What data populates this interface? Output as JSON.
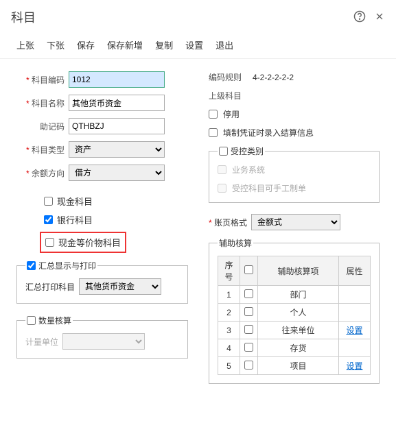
{
  "header": {
    "title": "科目"
  },
  "toolbar": {
    "prev": "上张",
    "next": "下张",
    "save": "保存",
    "saveNew": "保存新增",
    "copy": "复制",
    "settings": "设置",
    "exit": "退出"
  },
  "form": {
    "codeLabel": "科目编码",
    "codeValue": "1012",
    "nameLabel": "科目名称",
    "nameValue": "其他货币资金",
    "mnemonicLabel": "助记码",
    "mnemonicValue": "QTHBZJ",
    "typeLabel": "科目类型",
    "typeValue": "资产",
    "dirLabel": "余额方向",
    "dirValue": "借方"
  },
  "checks": {
    "cash": "现金科目",
    "bank": "银行科目",
    "cashEq": "现金等价物科目"
  },
  "right": {
    "codeRuleLabel": "编码规则",
    "codeRuleValue": "4-2-2-2-2-2",
    "parentLabel": "上级科目",
    "disable": "停用",
    "fillSettle": "填制凭证时录入结算信息"
  },
  "controlled": {
    "legend": "受控类别",
    "biz": "业务系统",
    "manual": "受控科目可手工制单"
  },
  "pageFmt": {
    "label": "账页格式",
    "value": "金额式"
  },
  "summary": {
    "legend": "汇总显示与打印",
    "printLabel": "汇总打印科目",
    "printValue": "其他货币资金"
  },
  "qty": {
    "legend": "数量核算",
    "unitLabel": "计量单位"
  },
  "aux": {
    "legend": "辅助核算",
    "colSeq": "序号",
    "colItem": "辅助核算项",
    "colAttr": "属性",
    "rows": [
      {
        "seq": "1",
        "item": "部门",
        "attr": ""
      },
      {
        "seq": "2",
        "item": "个人",
        "attr": ""
      },
      {
        "seq": "3",
        "item": "往来单位",
        "attr": "设置"
      },
      {
        "seq": "4",
        "item": "存货",
        "attr": ""
      },
      {
        "seq": "5",
        "item": "项目",
        "attr": "设置"
      }
    ]
  }
}
